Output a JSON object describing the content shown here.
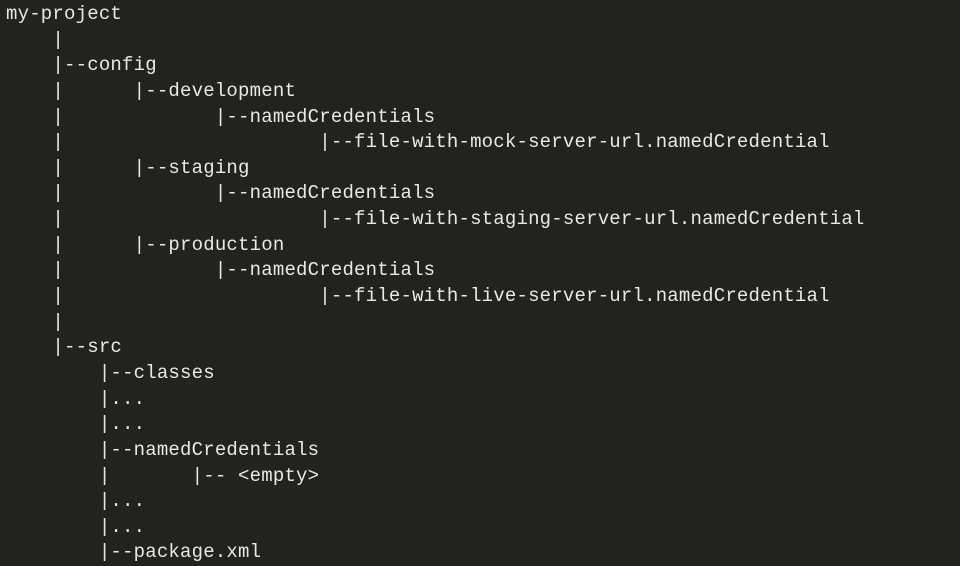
{
  "tree": {
    "lines": [
      "my-project",
      "    |",
      "    |--config",
      "    |      |--development",
      "    |             |--namedCredentials",
      "    |                      |--file-with-mock-server-url.namedCredential",
      "    |      |--staging",
      "    |             |--namedCredentials",
      "    |                      |--file-with-staging-server-url.namedCredential",
      "    |      |--production",
      "    |             |--namedCredentials",
      "    |                      |--file-with-live-server-url.namedCredential",
      "    |",
      "    |--src",
      "        |--classes",
      "        |...",
      "        |...",
      "        |--namedCredentials",
      "        |       |-- <empty>",
      "        |...",
      "        |...",
      "        |--package.xml"
    ]
  }
}
